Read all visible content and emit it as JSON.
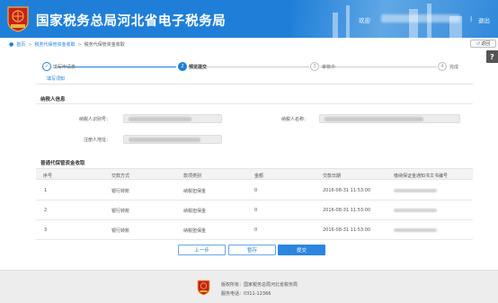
{
  "header": {
    "title": "国家税务总局河北省电子税务局",
    "welcome": "欢迎",
    "separator": "|",
    "logout": "退出",
    "colors": {
      "bar": "#1f7fd8",
      "emblem_red": "#c8201d",
      "emblem_gold": "#e8b53a"
    }
  },
  "breadcrumb": {
    "icon": "location-pin-icon",
    "items": [
      "首页",
      "税务代保管资金收取",
      "税务代保管资金收取"
    ],
    "separator": ">"
  },
  "toolbar": {
    "back_label": "返回",
    "back_icon": "return-arrow-icon",
    "help_label": "?"
  },
  "progress": {
    "steps": [
      {
        "num": "✓",
        "label": "填写申请表",
        "state": "done"
      },
      {
        "num": "2",
        "label": "预览提交",
        "state": "active"
      },
      {
        "num": "3",
        "label": "审核中",
        "state": "pending"
      },
      {
        "num": "4",
        "label": "完成",
        "state": "pending"
      }
    ],
    "current_tab": "填写须知"
  },
  "taxpayer": {
    "title": "纳税人信息",
    "id_label": "纳税人识别号：",
    "name_label": "纳税人名称：",
    "address_label": "注册人地址："
  },
  "table": {
    "title": "普通代保管资金收取",
    "columns": [
      "序号",
      "交款方式",
      "款项类别",
      "金额",
      "交款日期",
      "缴纳保证金通知书文书编号"
    ],
    "rows": [
      {
        "no": "1",
        "method": "银行转账",
        "type": "纳税担保金",
        "amount": "0",
        "date": "2016-08-31 11:53:00"
      },
      {
        "no": "2",
        "method": "银行转账",
        "type": "纳税担保金",
        "amount": "0",
        "date": "2016-08-31 11:53:00"
      },
      {
        "no": "3",
        "method": "银行转账",
        "type": "纳税担保金",
        "amount": "0",
        "date": "2016-08-31 11:53:00"
      }
    ]
  },
  "actions": {
    "prev": "上一步",
    "save": "暂存",
    "submit": "提交"
  },
  "footer": {
    "copyright": "版权所有：国家税务总局河北省税务局",
    "hotline": "服务电话：0311-12366"
  }
}
